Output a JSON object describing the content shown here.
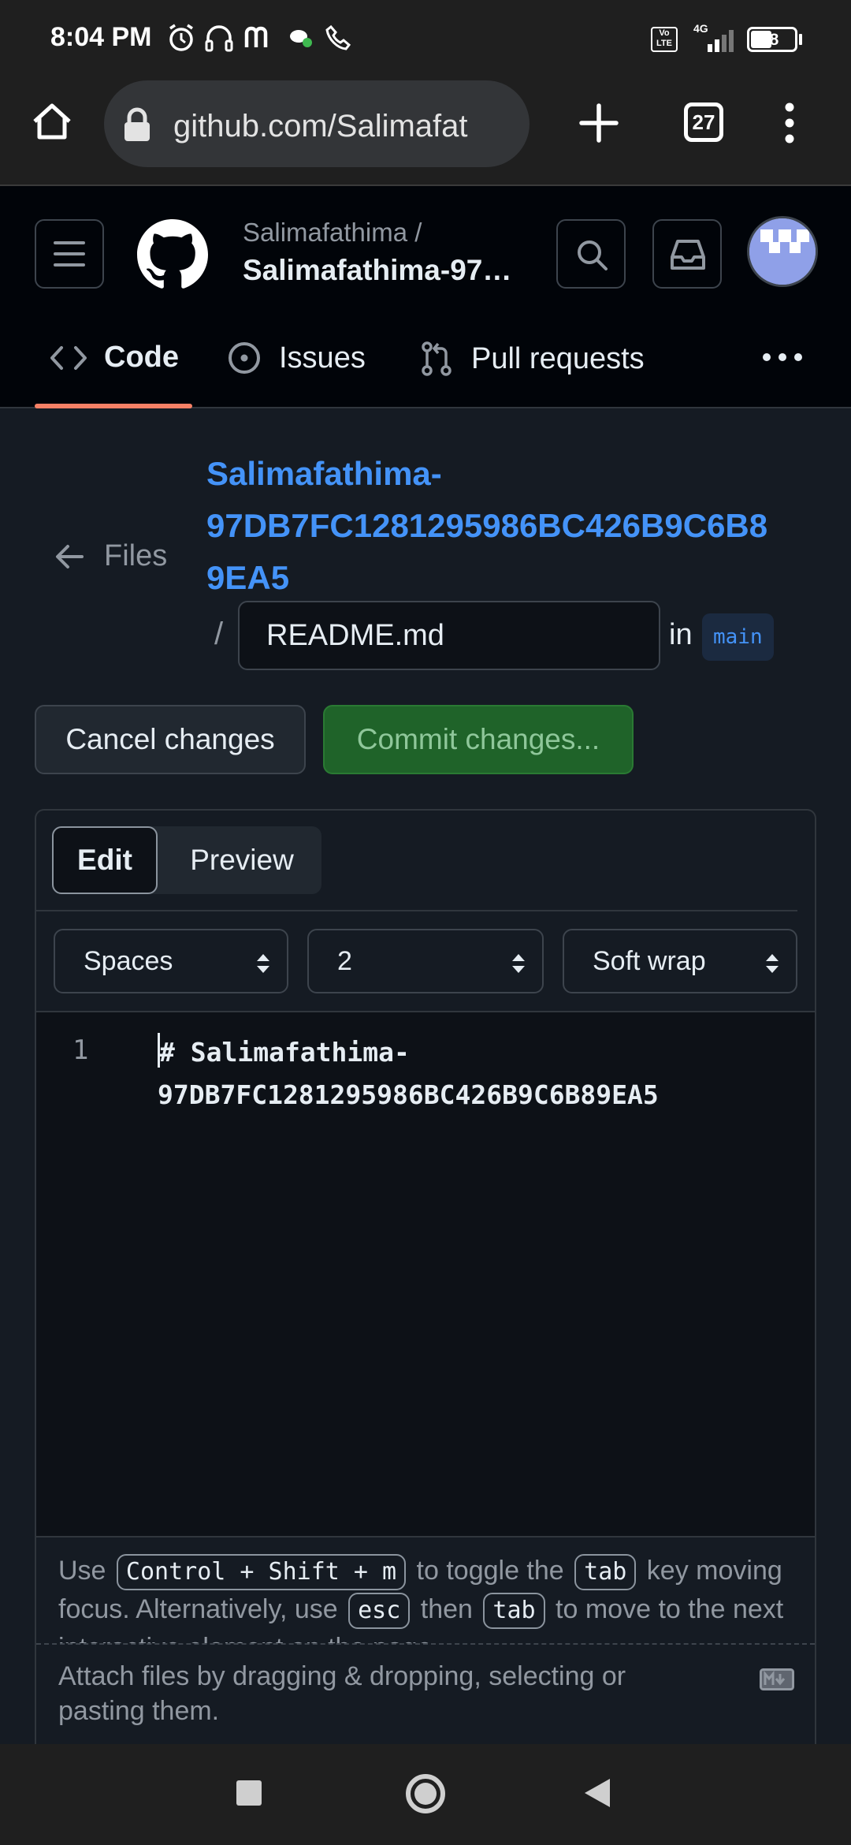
{
  "status_bar": {
    "time": "8:04 PM",
    "battery": "48",
    "network": "4G",
    "volte": "Vo LTE"
  },
  "browser": {
    "url": "github.com/Salimafat",
    "tab_count": "27"
  },
  "repo_header": {
    "owner": "Salimafathima /",
    "repo": "Salimafathima-97…"
  },
  "repo_nav": {
    "code": "Code",
    "issues": "Issues",
    "pull_requests": "Pull requests"
  },
  "editor": {
    "back_label": "Files",
    "repo_link_line1": "Salimafathima-",
    "repo_link_line2": "97DB7FC1281295986BC426B9C6B8",
    "repo_link_line3": "9EA5",
    "path_separator": "/",
    "filename": "README.md",
    "in_label": "in",
    "branch": "main",
    "cancel_label": "Cancel changes",
    "commit_label": "Commit changes...",
    "tab_edit": "Edit",
    "tab_preview": "Preview",
    "indent_mode": "Spaces",
    "indent_size": "2",
    "wrap_mode": "Soft wrap",
    "line_number": "1",
    "code_line1": "# Salimafathima-",
    "code_line2": "97DB7FC1281295986BC426B9C6B89EA5",
    "hint_use": "Use",
    "hint_kbd_shortcut": "Control + Shift + m",
    "hint_toggle": "to toggle the",
    "hint_kbd_tab": "tab",
    "hint_key": "key",
    "hint_moving": "moving focus. Alternatively, use",
    "hint_kbd_esc": "esc",
    "hint_then": "then",
    "hint_kbd_tab2": "tab",
    "hint_to_move": "to move",
    "hint_cutoff": "to the next interactive element on the page.",
    "attach_text_line1": "Attach files by dragging & dropping, selecting or",
    "attach_text_line2": "pasting them."
  },
  "colors": {
    "link_blue": "#4493f8",
    "commit_green": "#238636",
    "nav_underline": "#f78166"
  }
}
